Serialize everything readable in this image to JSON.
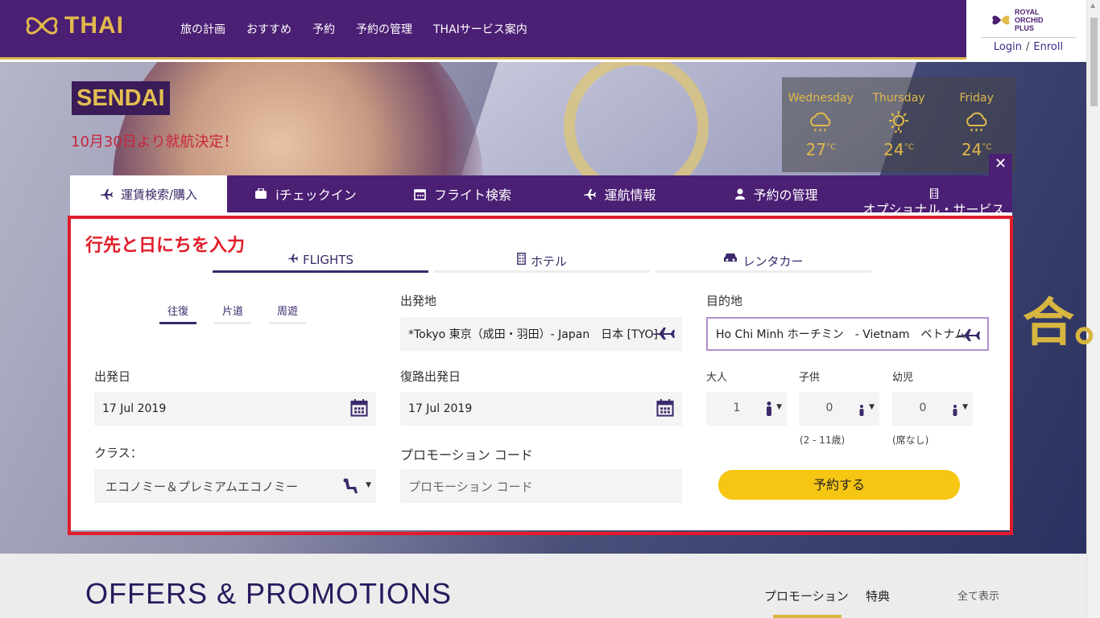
{
  "header": {
    "brand": "THAI",
    "nav": [
      "旅の計画",
      "おすすめ",
      "予約",
      "予約の管理",
      "THAIサービス案内"
    ],
    "rop": {
      "line1": "ROYAL",
      "line2": "ORCHID",
      "line3": "PLUS",
      "small": "THAI",
      "login": "Login",
      "separator": "/",
      "enroll": "Enroll"
    }
  },
  "hero": {
    "title": "SENDAI",
    "subtitle": "10月30日より就航決定！",
    "deco": "合。"
  },
  "weather": [
    {
      "day": "Wednesday",
      "temp": "27",
      "unit": "°C",
      "icon": "rain-cloud-icon"
    },
    {
      "day": "Thursday",
      "temp": "24",
      "unit": "°C",
      "icon": "sun-cloud-rain-icon"
    },
    {
      "day": "Friday",
      "temp": "24",
      "unit": "°C",
      "icon": "rain-cloud-icon"
    }
  ],
  "tabs": {
    "fare": "運賃検索/購入",
    "checkin": "iチェックイン",
    "flight_search": "フライト検索",
    "flight_status": "運航情報",
    "manage": "予約の管理",
    "optional": "オプショナル・サービス",
    "close": "✕"
  },
  "annotation": "行先と日にちを入力",
  "subtabs": {
    "flights": "FLIGHTS",
    "hotel": "ホテル",
    "car": "レンタカー"
  },
  "trip_types": [
    "往復",
    "片道",
    "周遊"
  ],
  "form": {
    "origin_label": "出発地",
    "origin_value": "*Tokyo 東京（成田・羽田）- Japan　日本 [TYO]",
    "dest_label": "目的地",
    "dest_value": "Ho Chi Minh ホーチミン　- Vietnam　ベトナム",
    "depart_label": "出発日",
    "depart_value": "17 Jul 2019",
    "return_label": "復路出発日",
    "return_value": "17 Jul 2019",
    "adult_label": "大人",
    "adult_value": "1",
    "child_label": "子供",
    "child_value": "0",
    "child_note": "(2 - 11歳)",
    "infant_label": "幼児",
    "infant_value": "0",
    "infant_note": "(席なし)",
    "class_label": "クラス：",
    "class_value": "エコノミー＆プレミアムエコノミー",
    "promo_label": "プロモーション コード",
    "promo_placeholder": "プロモーション コード",
    "submit": "予約する"
  },
  "offers": {
    "title": "OFFERS & PROMOTIONS",
    "tab_promotion": "プロモーション",
    "tab_benefits": "特典",
    "view_all": "全て表示"
  },
  "colors": {
    "brand_purple": "#4b1f74",
    "gold": "#e2b94b",
    "annotation_red": "#e11d2a",
    "button_yellow": "#f6c613"
  }
}
